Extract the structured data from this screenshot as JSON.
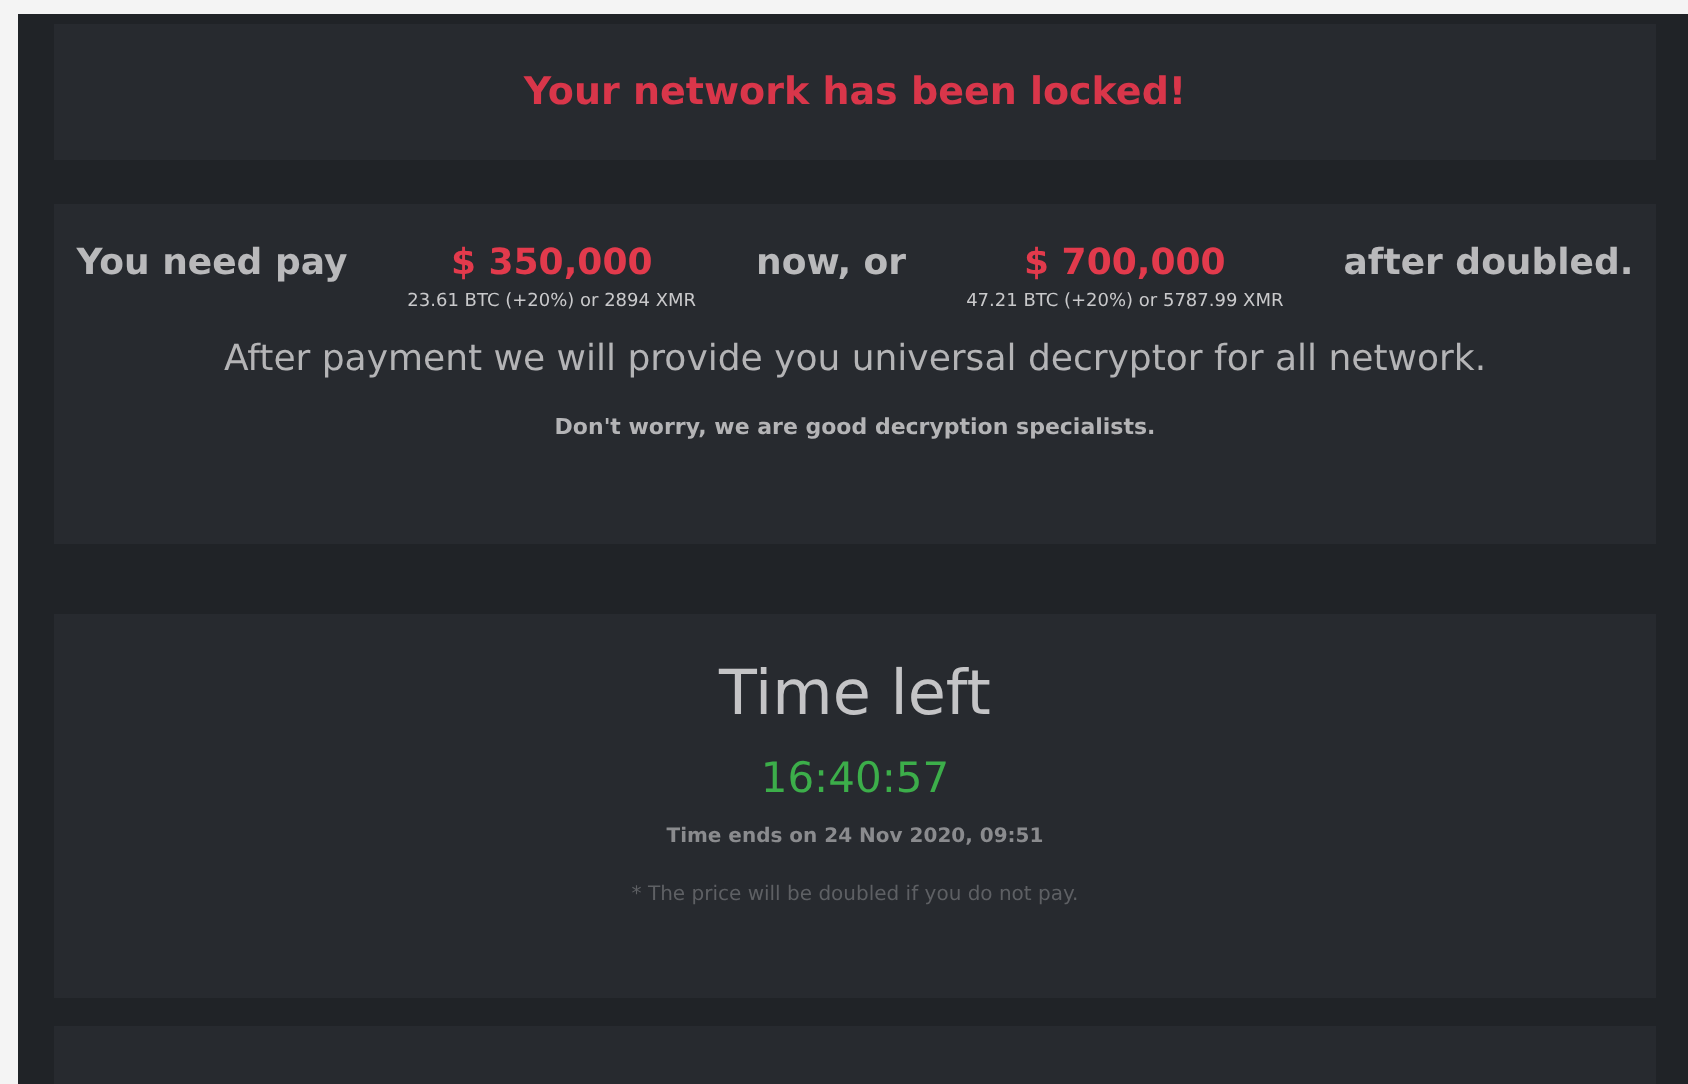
{
  "header": {
    "title": "Your network has been locked!"
  },
  "payment": {
    "lead": "You need pay",
    "offers": [
      {
        "amount": "$ 350,000",
        "crypto": "23.61 BTC (+20%) or 2894 XMR"
      },
      {
        "amount": "$ 700,000",
        "crypto": "47.21 BTC (+20%) or 5787.99 XMR"
      }
    ],
    "joiner": "now, or",
    "tail": "after doubled.",
    "promise": "After payment we will provide you universal decryptor for all network.",
    "reassurance": "Don't worry, we are good decryption specialists."
  },
  "timer": {
    "title": "Time left",
    "countdown": "16:40:57",
    "ends": "Time ends on 24 Nov 2020, 09:51",
    "note": "* The price will be doubled if you do not pay."
  }
}
